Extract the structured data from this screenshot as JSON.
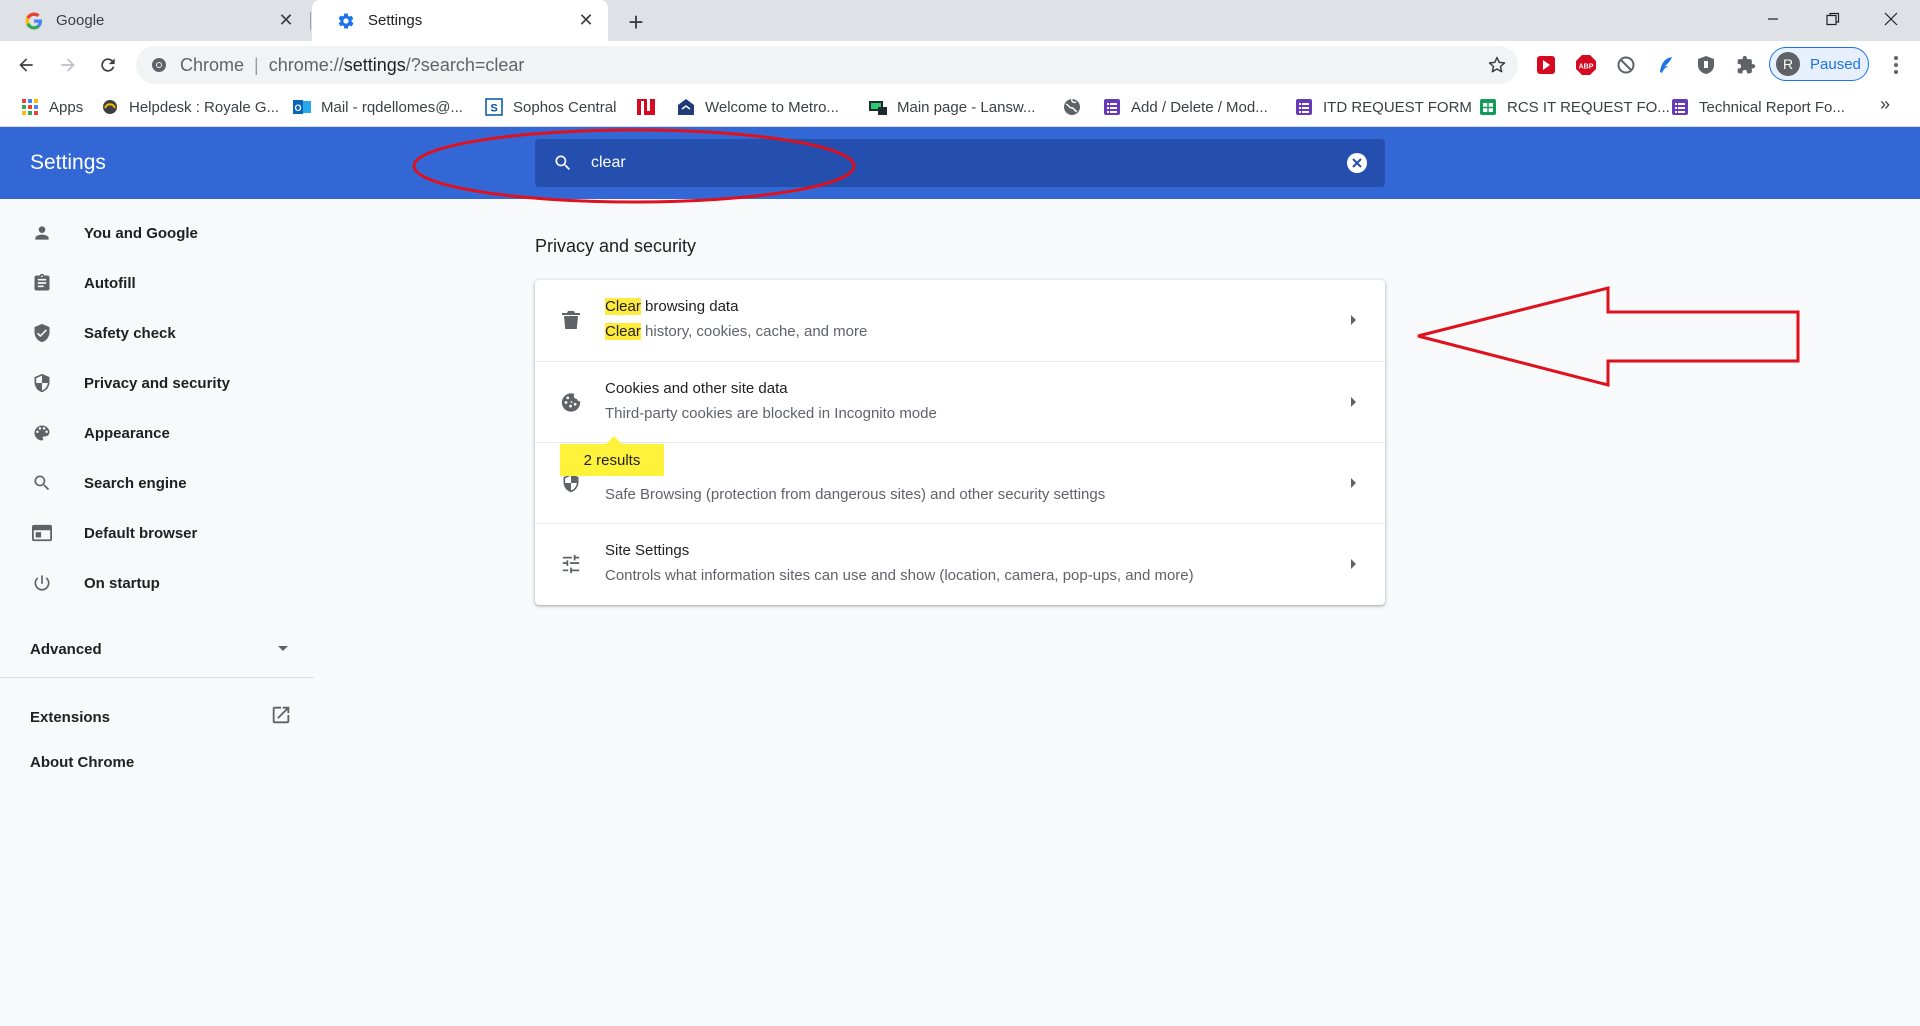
{
  "tabs": [
    {
      "title": "Google",
      "favicon": "google-icon"
    },
    {
      "title": "Settings",
      "favicon": "settings-gear-icon"
    }
  ],
  "omnibox": {
    "site_chip": "Chrome",
    "url_host": "chrome://",
    "url_path_strong": "settings",
    "url_rest": "/?search=clear"
  },
  "profile": {
    "initial": "R",
    "label": "Paused"
  },
  "bookmarks": [
    {
      "label": "Apps",
      "icon": "apps-grid-icon"
    },
    {
      "label": "Helpdesk : Royale G...",
      "icon": "helpdesk-icon"
    },
    {
      "label": "Mail - rqdellomes@...",
      "icon": "outlook-icon"
    },
    {
      "label": "Sophos Central",
      "icon": "sophos-icon"
    },
    {
      "label": "",
      "icon": "red-logo-icon"
    },
    {
      "label": "Welcome to Metro...",
      "icon": "metro-icon"
    },
    {
      "label": "Main page - Lansw...",
      "icon": "lansweeper-icon"
    },
    {
      "label": "",
      "icon": "globe-icon"
    },
    {
      "label": "Add / Delete / Mod...",
      "icon": "form-icon"
    },
    {
      "label": "ITD REQUEST FORM",
      "icon": "form-icon"
    },
    {
      "label": "RCS IT REQUEST FO...",
      "icon": "sheets-icon"
    },
    {
      "label": "Technical Report Fo...",
      "icon": "form-icon"
    }
  ],
  "header": {
    "title": "Settings"
  },
  "search": {
    "value": "clear"
  },
  "sidebar": {
    "items": [
      {
        "label": "You and Google",
        "icon": "person-icon"
      },
      {
        "label": "Autofill",
        "icon": "clipboard-icon"
      },
      {
        "label": "Safety check",
        "icon": "shield-check-icon"
      },
      {
        "label": "Privacy and security",
        "icon": "shield-half-icon"
      },
      {
        "label": "Appearance",
        "icon": "palette-icon"
      },
      {
        "label": "Search engine",
        "icon": "search-icon"
      },
      {
        "label": "Default browser",
        "icon": "browser-window-icon"
      },
      {
        "label": "On startup",
        "icon": "power-icon"
      }
    ],
    "advanced": "Advanced",
    "extensions": "Extensions",
    "about": "About Chrome"
  },
  "main": {
    "section_title": "Privacy and security",
    "rows": [
      {
        "title_hl": "Clear",
        "title_rest": " browsing data",
        "sub_hl": "Clear",
        "sub_rest": " history, cookies, cache, and more",
        "icon": "trash-icon"
      },
      {
        "title": "Cookies and other site data",
        "sub": "Third-party cookies are blocked in Incognito mode",
        "icon": "cookie-icon"
      },
      {
        "title": "",
        "sub": "Safe Browsing (protection from dangerous sites) and other security settings",
        "icon": "shield-half-icon"
      },
      {
        "title": "Site Settings",
        "sub": "Controls what information sites can use and show (location, camera, pop-ups, and more)",
        "icon": "sliders-icon"
      }
    ],
    "results_bubble": "2 results"
  },
  "colors": {
    "header_blue": "#3367d6",
    "search_blue": "#254faf",
    "highlight_yellow": "#ffeb3b",
    "annotation_red": "#e0101c"
  }
}
